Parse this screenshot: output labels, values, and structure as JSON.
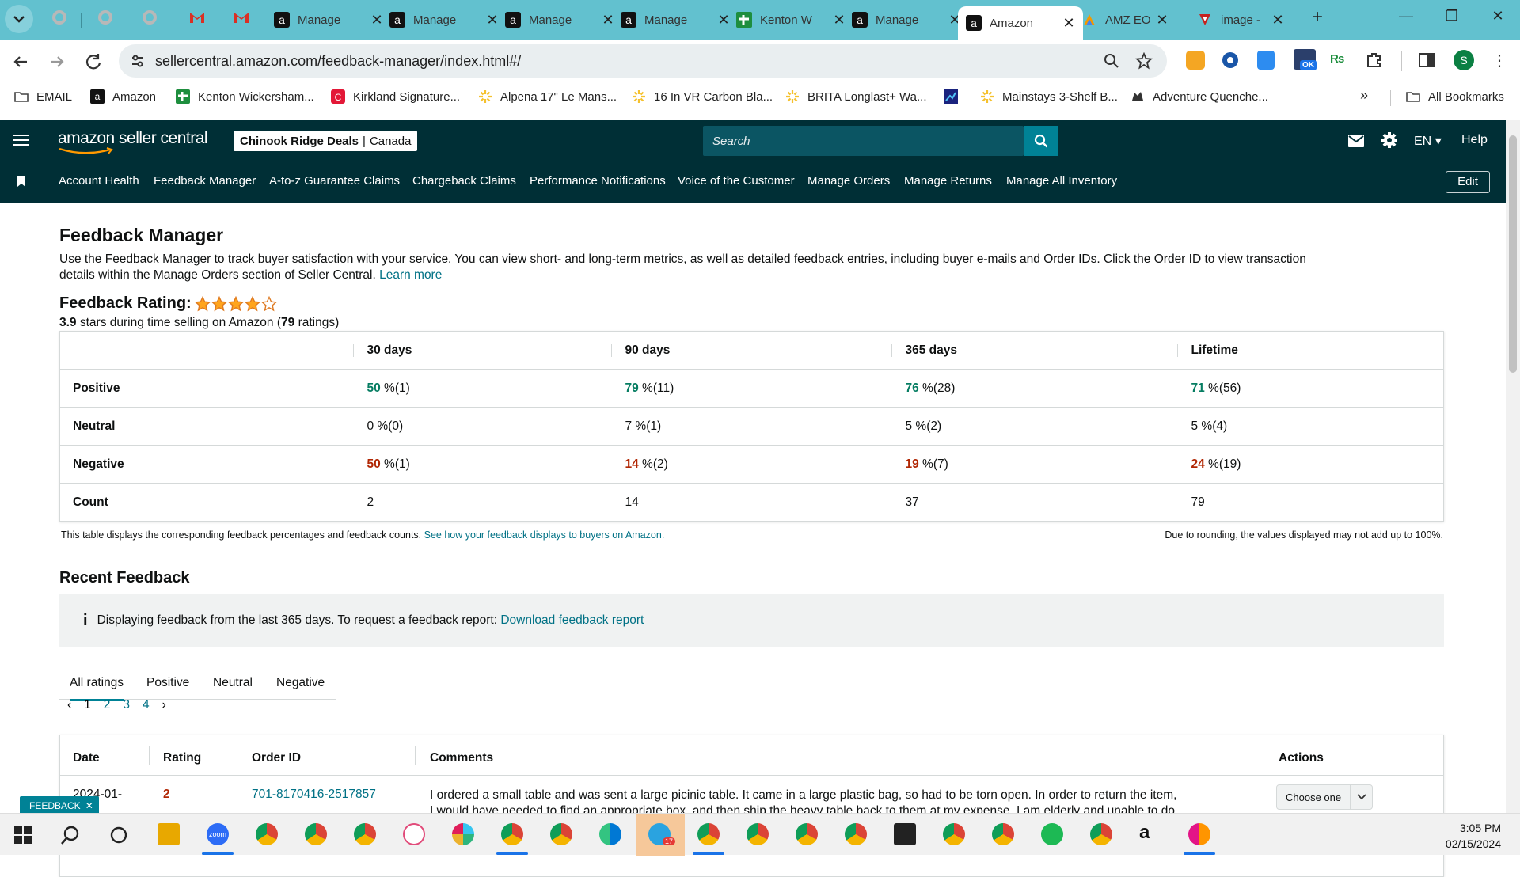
{
  "browser": {
    "tabs": [
      {
        "title": "Manage",
        "icon": "amazon-icon"
      },
      {
        "title": "Manage",
        "icon": "amazon-icon"
      },
      {
        "title": "Manage",
        "icon": "amazon-icon"
      },
      {
        "title": "Manage",
        "icon": "amazon-icon"
      },
      {
        "title": "Kenton W",
        "icon": "sheets-icon"
      },
      {
        "title": "Manage",
        "icon": "amazon-icon"
      },
      {
        "title": "Amazon",
        "icon": "amazon-icon"
      },
      {
        "title": "AMZ EO",
        "icon": "app-icon"
      },
      {
        "title": "image -",
        "icon": "image-icon"
      }
    ],
    "url": "sellercentral.amazon.com/feedback-manager/index.html#/",
    "bookmarks": [
      "EMAIL",
      "Amazon",
      "Kenton Wickersham...",
      "Kirkland Signature...",
      "Alpena 17\" Le Mans...",
      "16 In VR Carbon Bla...",
      "BRITA Longlast+ Wa...",
      "",
      "Mainstays 3-Shelf B...",
      "Adventure Quenche..."
    ],
    "all_bookmarks": "All Bookmarks",
    "profile_initial": "S",
    "ok_badge": "OK"
  },
  "header": {
    "logo": "amazon seller central",
    "store_name": "Chinook Ridge Deals",
    "store_region": "Canada",
    "search_placeholder": "Search",
    "language": "EN",
    "help": "Help"
  },
  "nav": {
    "items": [
      "Account Health",
      "Feedback Manager",
      "A-to-z Guarantee Claims",
      "Chargeback Claims",
      "Performance Notifications",
      "Voice of the Customer",
      "Manage Orders",
      "Manage Returns",
      "Manage All Inventory"
    ],
    "edit": "Edit"
  },
  "page": {
    "title": "Feedback Manager",
    "intro_line1": "Use the Feedback Manager to track buyer satisfaction with your service. You can view short- and long-term metrics, as well as detailed feedback entries, including buyer e-mails and Order IDs. Click the Order ID to view transaction",
    "intro_line2": "details within the Manage Orders section of Seller Central.",
    "learn_more": "Learn more",
    "rating_label": "Feedback Rating:",
    "rating_stars": 3.9,
    "rating_value": "3.9",
    "rating_text_mid": " stars during time selling on Amazon (",
    "rating_count": "79",
    "rating_text_end": " ratings)"
  },
  "feedback_table": {
    "headers": [
      "",
      "30 days",
      "90 days",
      "365 days",
      "Lifetime"
    ],
    "rows": [
      {
        "label": "Positive",
        "cells": [
          {
            "pct": "50",
            "rest": " %(1)"
          },
          {
            "pct": "79",
            "rest": " %(11)"
          },
          {
            "pct": "76",
            "rest": " %(28)"
          },
          {
            "pct": "71",
            "rest": " %(56)"
          }
        ]
      },
      {
        "label": "Neutral",
        "cells": [
          {
            "pct": "0",
            "rest": " %(0)"
          },
          {
            "pct": "7",
            "rest": " %(1)"
          },
          {
            "pct": "5",
            "rest": " %(2)"
          },
          {
            "pct": "5",
            "rest": " %(4)"
          }
        ]
      },
      {
        "label": "Negative",
        "cells": [
          {
            "pct": "50",
            "rest": " %(1)"
          },
          {
            "pct": "14",
            "rest": " %(2)"
          },
          {
            "pct": "19",
            "rest": " %(7)"
          },
          {
            "pct": "24",
            "rest": " %(19)"
          }
        ]
      },
      {
        "label": "Count",
        "cells": [
          {
            "pct": "2",
            "rest": ""
          },
          {
            "pct": "14",
            "rest": ""
          },
          {
            "pct": "37",
            "rest": ""
          },
          {
            "pct": "79",
            "rest": ""
          }
        ]
      }
    ],
    "note_left": "This table displays the corresponding feedback percentages and feedback counts.",
    "note_link": "See how your feedback displays to buyers on Amazon.",
    "note_right": "Due to rounding, the values displayed may not add up to 100%."
  },
  "recent": {
    "title": "Recent Feedback",
    "info_text": "Displaying feedback from the last 365 days. To request a feedback report:",
    "info_link": "Download feedback report",
    "tabs": [
      "All ratings",
      "Positive",
      "Neutral",
      "Negative"
    ],
    "pages": [
      "1",
      "2",
      "3",
      "4"
    ],
    "columns": [
      "Date",
      "Rating",
      "Order ID",
      "Comments",
      "Actions"
    ],
    "row": {
      "date": "2024-01-",
      "rating": "2",
      "order_id": "701-8170416-2517857",
      "comment_line1": "I ordered a small table and was sent a large picinic table. It came in a large plastic bag, so had to be torn open. In order to return the item,",
      "comment_line2": "I would have needed to find an appropriate box, and then ship the heavy table back to them at my expense. I am elderly and unable to do",
      "action": "Choose one"
    }
  },
  "feedback_tab": "FEEDBACK",
  "taskbar": {
    "time": "3:05 PM",
    "date": "02/15/2024",
    "badge": "17",
    "zoom": "zoom"
  }
}
